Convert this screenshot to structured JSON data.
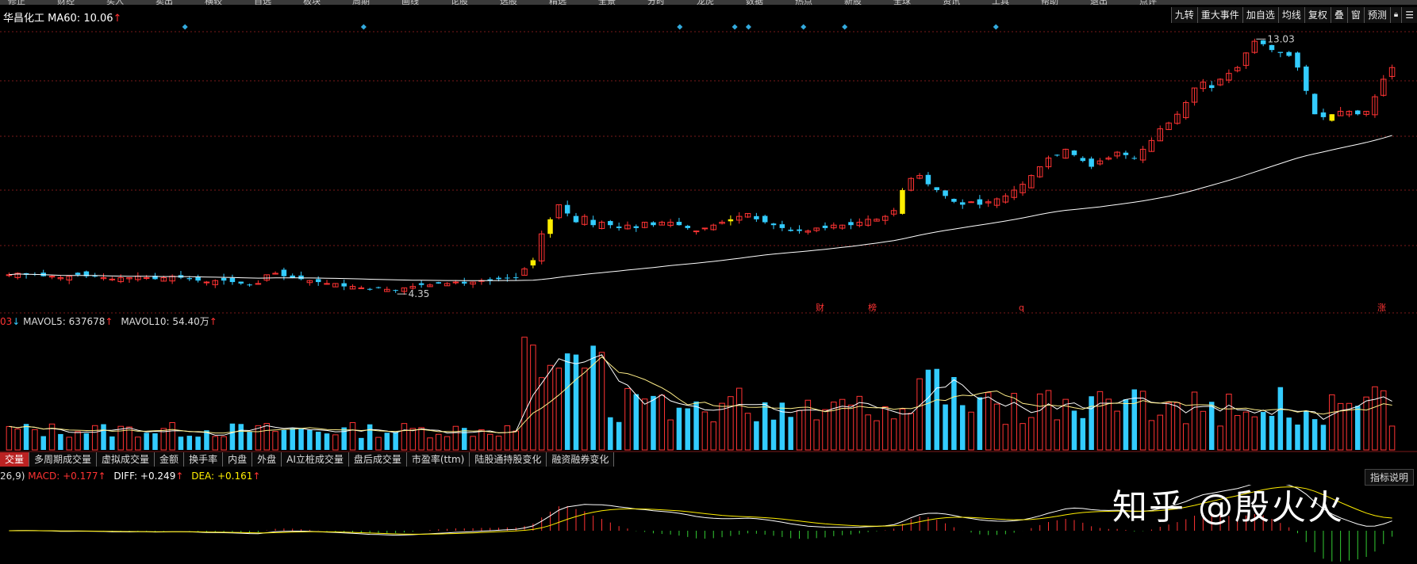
{
  "top_menu": [
    "修正",
    "财经",
    "买入",
    "卖出",
    "横较",
    "自选",
    "板块",
    "周期",
    "画线",
    "论股",
    "选股",
    "精选",
    "全景",
    "分时",
    "龙虎",
    "数据",
    "热点",
    "新股",
    "全球",
    "资讯",
    "工具",
    "帮助",
    "退出",
    "点评"
  ],
  "header": {
    "stock_name": "华昌化工",
    "ma_label": "MA60:",
    "ma_value": "10.06",
    "ma_arrow": "↑"
  },
  "right_toolbar": [
    "九转",
    "重大事件",
    "加自选",
    "均线",
    "复权",
    "叠",
    "窗",
    "预测"
  ],
  "main_annotations": {
    "high_label": "13.03",
    "low_label": "4.35",
    "event_markers": [
      "财",
      "榜",
      "q",
      "涨"
    ]
  },
  "volume_header": {
    "prefix": "03",
    "prefix_arrow": "↓",
    "mavol5_label": "MAVOL5:",
    "mavol5_value": "637678",
    "mavol5_arrow": "↑",
    "mavol10_label": "MAVOL10:",
    "mavol10_value": "54.40万",
    "mavol10_arrow": "↑"
  },
  "indicator_tabs": [
    "交量",
    "多周期成交量",
    "虚拟成交量",
    "金额",
    "换手率",
    "内盘",
    "外盘",
    "AI立桩成交量",
    "盘后成交量",
    "市盈率(ttm)",
    "陆股通持股变化",
    "融资融券变化"
  ],
  "macd_header": {
    "params": "26,9)",
    "macd_label": "MACD:",
    "macd_value": "+0.177",
    "macd_arrow": "↑",
    "diff_label": "DIFF:",
    "diff_value": "+0.249",
    "diff_arrow": "↑",
    "dea_label": "DEA:",
    "dea_value": "+0.161",
    "dea_arrow": "↑"
  },
  "indicator_help": "指标说明",
  "watermark": "知乎 @殷火火",
  "colors": {
    "up": "#ff3333",
    "down": "#33ccff",
    "ma60": "#ffffff",
    "highlight": "#ffee00",
    "background": "#000000",
    "grid": "#7a1a1a"
  },
  "chart_data": {
    "type": "candlestick",
    "title": "华昌化工",
    "ylim": [
      4.0,
      13.5
    ],
    "high": 13.03,
    "low": 4.35,
    "ma60_last": 10.06,
    "close_series": [
      4.9,
      4.95,
      4.9,
      4.9,
      4.85,
      4.85,
      4.8,
      4.85,
      4.9,
      4.85,
      4.85,
      4.8,
      4.75,
      4.8,
      4.8,
      4.85,
      4.8,
      4.75,
      4.8,
      4.85,
      4.8,
      4.75,
      4.7,
      4.65,
      4.7,
      4.7,
      4.65,
      4.6,
      4.55,
      4.6,
      4.9,
      4.95,
      4.85,
      4.8,
      4.75,
      4.7,
      4.65,
      4.6,
      4.6,
      4.5,
      4.5,
      4.45,
      4.4,
      4.45,
      4.4,
      4.35,
      4.45,
      4.5,
      4.55,
      4.55,
      4.6,
      4.6,
      4.65,
      4.6,
      4.65,
      4.7,
      4.7,
      4.75,
      4.8,
      4.8,
      5.1,
      5.4,
      6.3,
      6.8,
      7.3,
      7.0,
      6.7,
      6.9,
      6.6,
      6.7,
      6.6,
      6.5,
      6.6,
      6.5,
      6.7,
      6.6,
      6.7,
      6.7,
      6.6,
      6.5,
      6.4,
      6.5,
      6.6,
      6.7,
      6.8,
      6.9,
      7.0,
      6.8,
      6.7,
      6.6,
      6.5,
      6.4,
      6.4,
      6.4,
      6.5,
      6.5,
      6.6,
      6.6,
      6.6,
      6.7,
      6.8,
      6.8,
      6.9,
      7.1,
      7.8,
      8.2,
      8.3,
      8.0,
      7.8,
      7.6,
      7.4,
      7.3,
      7.4,
      7.3,
      7.4,
      7.5,
      7.6,
      7.8,
      8.0,
      8.3,
      8.6,
      8.9,
      9.0,
      9.2,
      9.0,
      8.8,
      8.6,
      8.8,
      8.9,
      9.1,
      9.0,
      8.9,
      9.2,
      9.5,
      9.9,
      10.1,
      10.4,
      10.8,
      11.3,
      11.5,
      11.3,
      11.6,
      11.8,
      12.0,
      12.5,
      12.9,
      12.8,
      12.6,
      12.5,
      12.4,
      12.0,
      11.2,
      10.4,
      10.3,
      10.4,
      10.5,
      10.5,
      10.4,
      10.5,
      11.0,
      11.6,
      12.0
    ]
  }
}
